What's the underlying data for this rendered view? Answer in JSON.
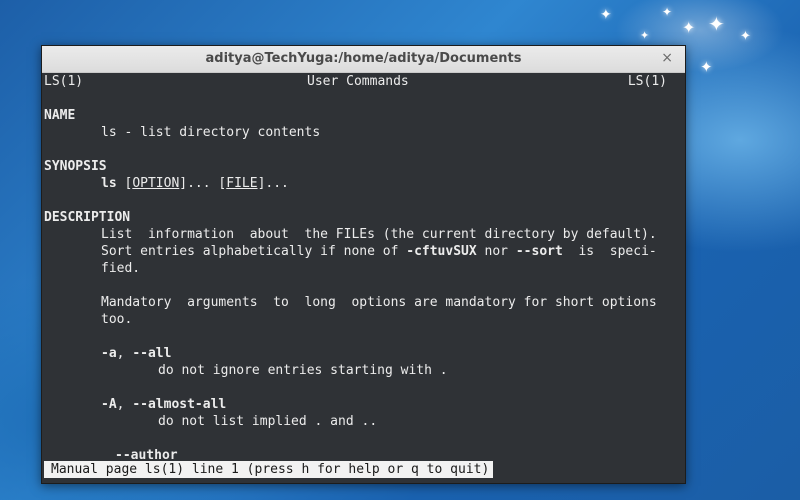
{
  "window": {
    "title": "aditya@TechYuga:/home/aditya/Documents",
    "close_glyph": "×"
  },
  "man": {
    "header_left": "LS(1)",
    "header_center": "User Commands",
    "header_right": "LS(1)",
    "name_heading": "NAME",
    "name_text": "ls - list directory contents",
    "synopsis_heading": "SYNOPSIS",
    "synopsis_cmd": "ls",
    "synopsis_option": "OPTION",
    "synopsis_file": "FILE",
    "synopsis_ellipsis": "...",
    "description_heading": "DESCRIPTION",
    "desc_line1": "List  information  about  the FILEs (the current directory by default).",
    "desc_line2_a": "Sort entries alphabetically if none of ",
    "desc_line2_b": "-cftuvSUX",
    "desc_line2_c": " nor ",
    "desc_line2_d": "--sort",
    "desc_line2_e": "  is  speci-",
    "desc_line3": "fied.",
    "mandatory_line1": "Mandatory  arguments  to  long  options are mandatory for short options",
    "mandatory_line2": "too.",
    "opt_a_short": "-a",
    "opt_a_long": "--all",
    "opt_a_desc": "do not ignore entries starting with .",
    "opt_A_short": "-A",
    "opt_A_long": "--almost-all",
    "opt_A_desc": "do not list implied . and ..",
    "opt_author": "--author",
    "comma": ", "
  },
  "status_bar": "Manual page ls(1) line 1 (press h for help or q to quit)"
}
